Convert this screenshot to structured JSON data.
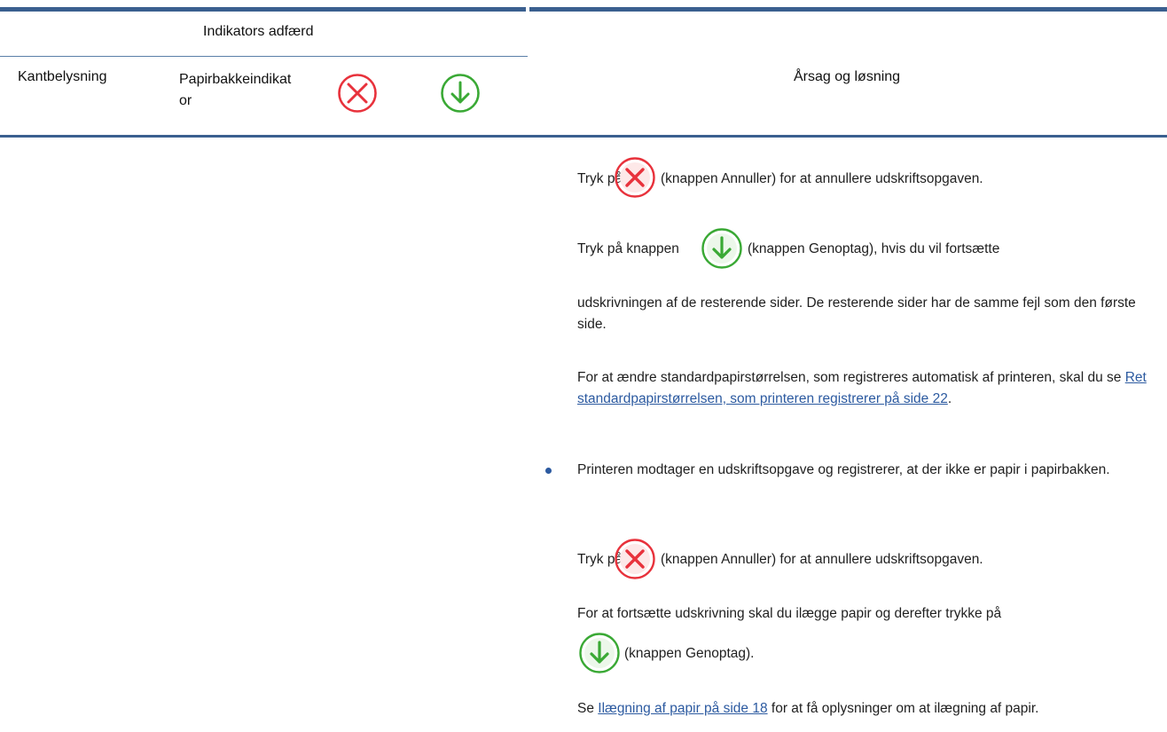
{
  "header": {
    "group_title": "Indikators adfærd",
    "col_edge": "Kantbelysning",
    "col_tray": "Papirbakkeindikat or",
    "col_cause": "Årsag og løsning"
  },
  "icons": {
    "cancel": "cancel-icon",
    "resume": "resume-icon",
    "cancel_color": "#e8323c",
    "resume_color": "#3aa935"
  },
  "content": {
    "p1_pre": "Tryk på",
    "p1_post": "(knappen Annuller) for at annullere udskriftsopgaven.",
    "p2_pre": "Tryk på knappen",
    "p2_post": "(knappen Genoptag), hvis du vil fortsætte",
    "p2_cont": "udskrivningen af de resterende sider. De resterende sider har de samme fejl som den første side.",
    "p3_text": "For at ændre standardpapirstørrelsen, som registreres automatisk af printeren, skal du se",
    "p3_link": "Ret standardpapirstørrelsen, som printeren registrerer på side 22",
    "p3_end": ".",
    "bullet_text": "Printeren modtager en udskriftsopgave og registrerer, at der ikke er papir i papirbakken.",
    "p4_pre": "Tryk på",
    "p4_post": "(knappen Annuller) for at annullere udskriftsopgaven.",
    "p5_text": "For at fortsætte udskrivning skal du ilægge papir og derefter trykke på",
    "p5_post": "(knappen Genoptag).",
    "p6_pre": "Se",
    "p6_link": "Ilægning af papir på side 18",
    "p6_post": "for at få oplysninger om at ilægning af papir."
  }
}
